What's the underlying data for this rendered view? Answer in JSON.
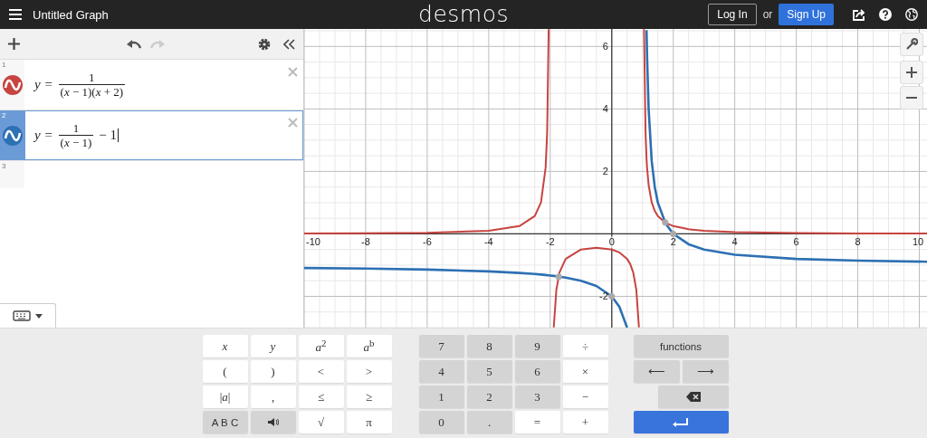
{
  "header": {
    "title": "Untitled Graph",
    "logo": "desmos",
    "login": "Log In",
    "or": "or",
    "signup": "Sign Up"
  },
  "expressions": [
    {
      "kind": "expression",
      "number": "1",
      "color": "#c74440",
      "selected": false,
      "lhs": "y =",
      "numerator": "1",
      "denominator": "(*x* − 1)(*x* + 2)"
    },
    {
      "kind": "expression",
      "number": "2",
      "color": "#2d70b3",
      "selected": true,
      "lhs": "y =",
      "numerator": "1",
      "denominator": "(*x* − 1)",
      "suffix": "− 1"
    },
    {
      "kind": "empty",
      "number": "3"
    }
  ],
  "graph": {
    "chart_data": {
      "type": "line",
      "xlim": [
        -10,
        10.25
      ],
      "ylim": [
        -3.0,
        6.56
      ],
      "xticks": [
        -10,
        -8,
        -6,
        -4,
        -2,
        0,
        2,
        4,
        6,
        8,
        10
      ],
      "yticks": [
        -2,
        2,
        4,
        6
      ],
      "x": [
        -10,
        -8,
        -6,
        -4,
        -3,
        -2.5,
        -2.3,
        -2.15,
        -2.1,
        -2.05,
        -2,
        -1.884,
        -1.8,
        -1.7,
        -1.5,
        -1,
        -0.5,
        0,
        0.25,
        0.5,
        0.6,
        0.7,
        0.8,
        0.884,
        1.05,
        1.1,
        1.133,
        1.15,
        1.2,
        1.3,
        1.4,
        1.5,
        1.75,
        2,
        2.5,
        3,
        4,
        6,
        8,
        10.25
      ],
      "series": [
        {
          "color": "#c74440",
          "values": [
            0.011,
            0.019,
            0.036,
            0.1,
            0.25,
            0.571,
            1.01,
            2.116,
            3.23,
            6.55,
            null,
            -2.99,
            -1.786,
            -1.235,
            -0.8,
            -0.5,
            -0.444,
            -0.5,
            -0.593,
            -0.8,
            -0.96,
            -1.235,
            -1.786,
            -2.99,
            6.55,
            3.23,
            2.4,
            2.116,
            1.563,
            1.01,
            0.735,
            0.571,
            0.356,
            0.25,
            0.148,
            0.1,
            0.056,
            0.025,
            0.014,
            0.009
          ]
        },
        {
          "color": "#2d70b3",
          "values": [
            -1.091,
            -1.111,
            -1.143,
            -1.2,
            -1.25,
            -1.286,
            -1.303,
            -1.317,
            -1.323,
            -1.328,
            -1.333,
            -1.347,
            -1.357,
            -1.37,
            -1.4,
            -1.5,
            -1.667,
            -2,
            -2.333,
            -3,
            null,
            null,
            null,
            null,
            null,
            null,
            6.52,
            5.667,
            4,
            2.333,
            1.5,
            1,
            0.333,
            0,
            -0.333,
            -0.5,
            -0.667,
            -0.8,
            -0.857,
            -0.892
          ]
        }
      ],
      "grid": true
    }
  },
  "keypad": {
    "open": true,
    "groups": [
      {
        "rows": [
          [
            {
              "kind": "variable",
              "label": "x"
            },
            {
              "kind": "variable",
              "label": "y"
            },
            {
              "kind": "symbol",
              "label": "*a*$^{2}$"
            },
            {
              "kind": "symbol",
              "label": "*a*$^{b}$"
            }
          ],
          [
            {
              "kind": "symbol",
              "label": "("
            },
            {
              "kind": "symbol",
              "label": ")"
            },
            {
              "kind": "symbol",
              "label": "<"
            },
            {
              "kind": "symbol",
              "label": ">"
            }
          ],
          [
            {
              "kind": "symbol",
              "label": "|*a*|"
            },
            {
              "kind": "symbol",
              "label": ","
            },
            {
              "kind": "symbol",
              "label": "≤"
            },
            {
              "kind": "symbol",
              "label": "≥"
            }
          ],
          [
            {
              "kind": "word",
              "label": "A B C"
            },
            {
              "kind": "speaker"
            },
            {
              "kind": "symbol",
              "label": "√"
            },
            {
              "kind": "symbol",
              "label": "π"
            }
          ]
        ]
      },
      {
        "rows": [
          [
            {
              "kind": "digit",
              "label": "7"
            },
            {
              "kind": "digit",
              "label": "8"
            },
            {
              "kind": "digit",
              "label": "9"
            },
            {
              "kind": "symbol",
              "label": "÷"
            }
          ],
          [
            {
              "kind": "digit",
              "label": "4"
            },
            {
              "kind": "digit",
              "label": "5"
            },
            {
              "kind": "digit",
              "label": "6"
            },
            {
              "kind": "symbol",
              "label": "×"
            }
          ],
          [
            {
              "kind": "digit",
              "label": "1"
            },
            {
              "kind": "digit",
              "label": "2"
            },
            {
              "kind": "digit",
              "label": "3"
            },
            {
              "kind": "symbol",
              "label": "−"
            }
          ],
          [
            {
              "kind": "digit",
              "label": "0"
            },
            {
              "kind": "digit",
              "label": "."
            },
            {
              "kind": "symbol",
              "label": "="
            },
            {
              "kind": "symbol",
              "label": "+"
            }
          ]
        ]
      },
      {
        "rows": [
          [
            {
              "kind": "word",
              "label": "functions"
            }
          ],
          [
            {
              "kind": "arrow",
              "label": "⟵"
            },
            {
              "kind": "arrow",
              "label": "⟶"
            }
          ],
          [
            {
              "kind": "backspace"
            }
          ],
          [
            {
              "kind": "enter"
            }
          ]
        ]
      }
    ]
  }
}
